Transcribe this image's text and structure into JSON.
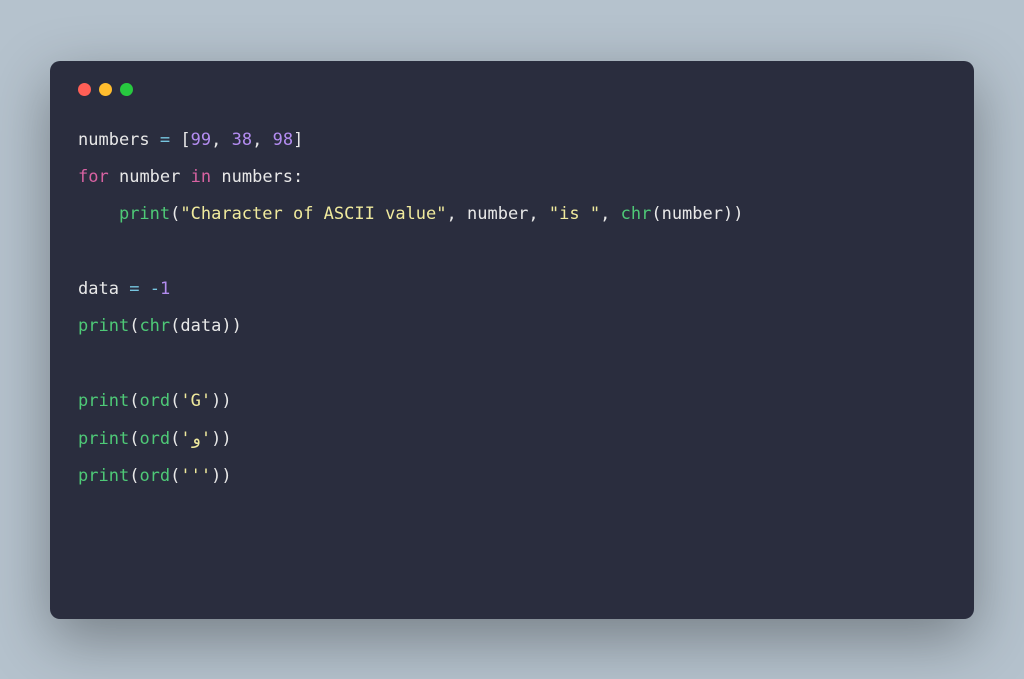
{
  "trafficLights": [
    "red",
    "yellow",
    "green"
  ],
  "code": {
    "line1": {
      "id1": "numbers",
      "sp1": " ",
      "op1": "=",
      "sp2": " ",
      "lb": "[",
      "n1": "99",
      "c1": ",",
      "sp3": " ",
      "n2": "38",
      "c2": ",",
      "sp4": " ",
      "n3": "98",
      "rb": "]"
    },
    "line2": {
      "kw1": "for",
      "sp1": " ",
      "id1": "number",
      "sp2": " ",
      "kw2": "in",
      "sp3": " ",
      "id2": "numbers",
      "colon": ":"
    },
    "line3": {
      "indent": "    ",
      "fn1": "print",
      "lp": "(",
      "str1": "\"Character of ASCII value\"",
      "c1": ",",
      "sp1": " ",
      "id1": "number",
      "c2": ",",
      "sp2": " ",
      "str2": "\"is \"",
      "c3": ",",
      "sp3": " ",
      "fn2": "chr",
      "lp2": "(",
      "id2": "number",
      "rp2": ")",
      "rp": ")"
    },
    "line4": {
      "id1": "data",
      "sp1": " ",
      "op1": "=",
      "sp2": " ",
      "op2": "-",
      "num": "1"
    },
    "line5": {
      "fn1": "print",
      "lp": "(",
      "fn2": "chr",
      "lp2": "(",
      "id1": "data",
      "rp2": ")",
      "rp": ")"
    },
    "line6": {
      "fn1": "print",
      "lp": "(",
      "fn2": "ord",
      "lp2": "(",
      "str1": "'G'",
      "rp2": ")",
      "rp": ")"
    },
    "line7": {
      "fn1": "print",
      "lp": "(",
      "fn2": "ord",
      "lp2": "(",
      "str1": "'و'",
      "rp2": ")",
      "rp": ")"
    },
    "line8": {
      "fn1": "print",
      "lp": "(",
      "fn2": "ord",
      "lp2": "(",
      "str1": "'''",
      "rp2": ")",
      "rp": ")"
    }
  }
}
